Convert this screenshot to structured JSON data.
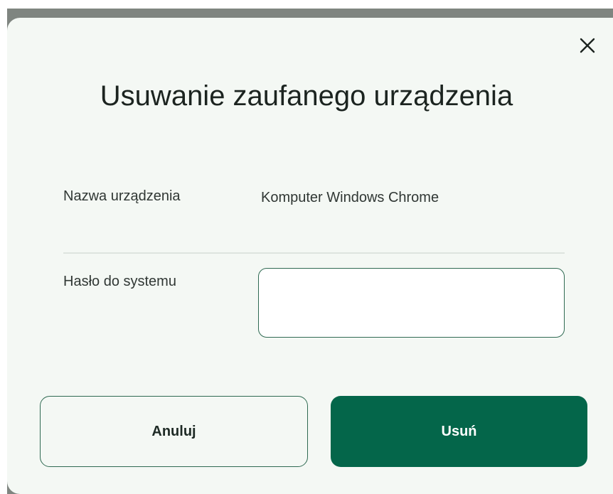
{
  "dialog": {
    "title": "Usuwanie zaufanego urządzenia",
    "close_icon": "close-icon",
    "device_name_label": "Nazwa urządzenia",
    "device_name_value": "Komputer Windows Chrome",
    "password_label": "Hasło do systemu",
    "password_value": "",
    "cancel_label": "Anuluj",
    "delete_label": "Usuń"
  },
  "colors": {
    "accent": "#04664a",
    "border": "#2f6a52",
    "dialog_bg": "#f4f8f4",
    "backdrop": "#7f8580"
  }
}
